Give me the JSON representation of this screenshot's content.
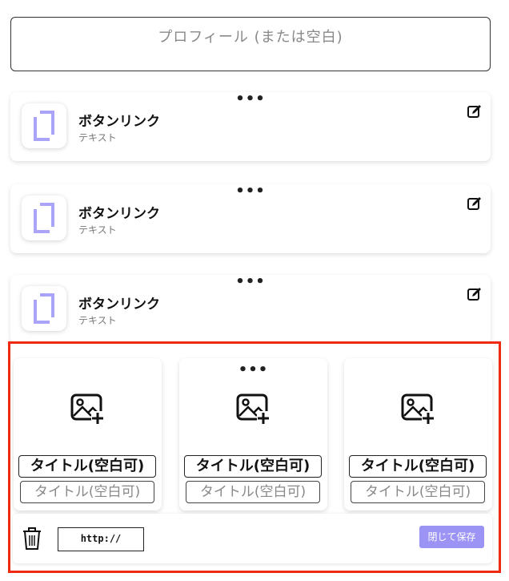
{
  "profile": {
    "placeholder": "プロフィール (または空白)"
  },
  "link_cards": [
    {
      "title": "ボタンリンク",
      "subtitle": "テキスト"
    },
    {
      "title": "ボタンリンク",
      "subtitle": "テキスト"
    },
    {
      "title": "ボタンリンク",
      "subtitle": "テキスト"
    }
  ],
  "drag_handle": "•••",
  "image_grid": {
    "tiles": [
      {
        "title": "タイトル(空白可)",
        "subtitle": "タイトル(空白可)"
      },
      {
        "title": "タイトル(空白可)",
        "subtitle": "タイトル(空白可)"
      },
      {
        "title": "タイトル(空白可)",
        "subtitle": "タイトル(空白可)"
      }
    ],
    "url_value": "http://",
    "save_label": "閉じて保存"
  },
  "colors": {
    "accent": "#9b94f5",
    "highlight_border": "#ee2a12",
    "icon_purple": "#a9a4f7"
  },
  "icons": [
    "page-icon",
    "edit-icon",
    "add-image-icon",
    "trash-icon"
  ]
}
